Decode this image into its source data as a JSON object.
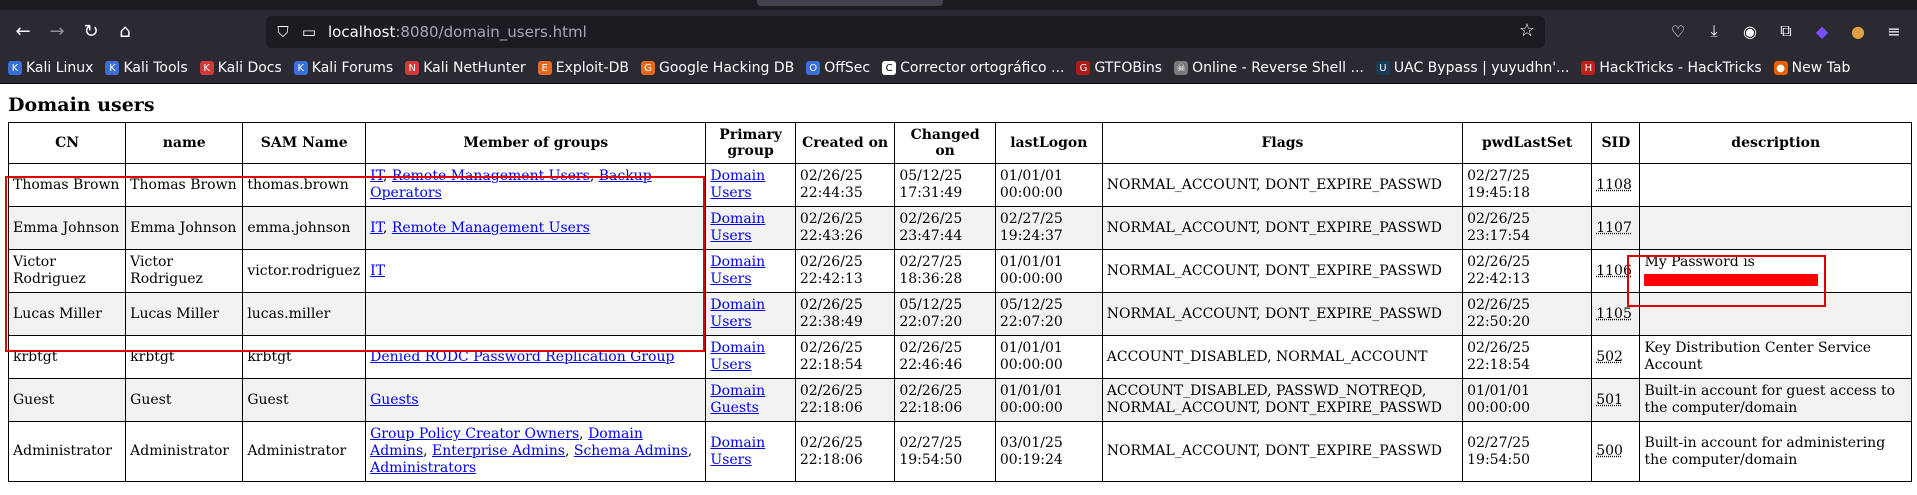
{
  "browser": {
    "url_host": "localhost",
    "url_path": ":8080/domain_users.html",
    "bookmarks": [
      {
        "label": "Kali Linux",
        "color": "#3a6fd8",
        "glyph": "K"
      },
      {
        "label": "Kali Tools",
        "color": "#3a6fd8",
        "glyph": "K"
      },
      {
        "label": "Kali Docs",
        "color": "#d13a3a",
        "glyph": "K"
      },
      {
        "label": "Kali Forums",
        "color": "#3a6fd8",
        "glyph": "K"
      },
      {
        "label": "Kali NetHunter",
        "color": "#d13a3a",
        "glyph": "N"
      },
      {
        "label": "Exploit-DB",
        "color": "#e36b1e",
        "glyph": "E"
      },
      {
        "label": "Google Hacking DB",
        "color": "#e36b1e",
        "glyph": "G"
      },
      {
        "label": "OffSec",
        "color": "#3a6fd8",
        "glyph": "O"
      },
      {
        "label": "Corrector ortográfico ...",
        "color": "#ffffff",
        "glyph": "C"
      },
      {
        "label": "GTFOBins",
        "color": "#b01919",
        "glyph": "G"
      },
      {
        "label": "Online - Reverse Shell ...",
        "color": "#7a7a7a",
        "glyph": "☠"
      },
      {
        "label": "UAC Bypass | yuyudhn'...",
        "color": "#1b3b5a",
        "glyph": "U"
      },
      {
        "label": "HackTricks - HackTricks",
        "color": "#c02020",
        "glyph": "H"
      },
      {
        "label": "New Tab",
        "color": "#e66000",
        "glyph": "●"
      }
    ]
  },
  "page": {
    "title": "Domain users",
    "columns": [
      "CN",
      "name",
      "SAM Name",
      "Member of groups",
      "Primary group",
      "Created on",
      "Changed on",
      "lastLogon",
      "Flags",
      "pwdLastSet",
      "SID",
      "description"
    ],
    "rows": [
      {
        "cn": "Thomas Brown",
        "name": "Thomas Brown",
        "sam": "thomas.brown",
        "groups": [
          "IT",
          "Remote Management Users",
          "Backup Operators"
        ],
        "primary": "Domain Users",
        "created": "02/26/25 22:44:35",
        "changed": "05/12/25 17:31:49",
        "lastlogon": "01/01/01 00:00:00",
        "flags": "NORMAL_ACCOUNT, DONT_EXPIRE_PASSWD",
        "pwdlastset": "02/27/25 19:45:18",
        "sid": "1108",
        "description": "",
        "redacted": false
      },
      {
        "cn": "Emma Johnson",
        "name": "Emma Johnson",
        "sam": "emma.johnson",
        "groups": [
          "IT",
          "Remote Management Users"
        ],
        "primary": "Domain Users",
        "created": "02/26/25 22:43:26",
        "changed": "02/26/25 23:47:44",
        "lastlogon": "02/27/25 19:24:37",
        "flags": "NORMAL_ACCOUNT, DONT_EXPIRE_PASSWD",
        "pwdlastset": "02/26/25 23:17:54",
        "sid": "1107",
        "description": "",
        "redacted": false
      },
      {
        "cn": "Victor Rodriguez",
        "name": "Victor Rodriguez",
        "sam": "victor.rodriguez",
        "groups": [
          "IT"
        ],
        "primary": "Domain Users",
        "created": "02/26/25 22:42:13",
        "changed": "02/27/25 18:36:28",
        "lastlogon": "01/01/01 00:00:00",
        "flags": "NORMAL_ACCOUNT, DONT_EXPIRE_PASSWD",
        "pwdlastset": "02/26/25 22:42:13",
        "sid": "1106",
        "description": "My Password is",
        "redacted": true
      },
      {
        "cn": "Lucas Miller",
        "name": "Lucas Miller",
        "sam": "lucas.miller",
        "groups": [],
        "primary": "Domain Users",
        "created": "02/26/25 22:38:49",
        "changed": "05/12/25 22:07:20",
        "lastlogon": "05/12/25 22:07:20",
        "flags": "NORMAL_ACCOUNT, DONT_EXPIRE_PASSWD",
        "pwdlastset": "02/26/25 22:50:20",
        "sid": "1105",
        "description": "",
        "redacted": false
      },
      {
        "cn": "krbtgt",
        "name": "krbtgt",
        "sam": "krbtgt",
        "groups": [
          "Denied RODC Password Replication Group"
        ],
        "primary": "Domain Users",
        "created": "02/26/25 22:18:54",
        "changed": "02/26/25 22:46:46",
        "lastlogon": "01/01/01 00:00:00",
        "flags": "ACCOUNT_DISABLED, NORMAL_ACCOUNT",
        "pwdlastset": "02/26/25 22:18:54",
        "sid": "502",
        "description": "Key Distribution Center Service Account",
        "redacted": false
      },
      {
        "cn": "Guest",
        "name": "Guest",
        "sam": "Guest",
        "groups": [
          "Guests"
        ],
        "primary": "Domain Guests",
        "created": "02/26/25 22:18:06",
        "changed": "02/26/25 22:18:06",
        "lastlogon": "01/01/01 00:00:00",
        "flags": "ACCOUNT_DISABLED, PASSWD_NOTREQD, NORMAL_ACCOUNT, DONT_EXPIRE_PASSWD",
        "pwdlastset": "01/01/01 00:00:00",
        "sid": "501",
        "description": "Built-in account for guest access to the computer/domain",
        "redacted": false
      },
      {
        "cn": "Administrator",
        "name": "Administrator",
        "sam": "Administrator",
        "groups": [
          "Group Policy Creator Owners",
          "Domain Admins",
          "Enterprise Admins",
          "Schema Admins",
          "Administrators"
        ],
        "primary": "Domain Users",
        "created": "02/26/25 22:18:06",
        "changed": "02/27/25 19:54:50",
        "lastlogon": "03/01/25 00:19:24",
        "flags": "NORMAL_ACCOUNT, DONT_EXPIRE_PASSWD",
        "pwdlastset": "02/27/25 19:54:50",
        "sid": "500",
        "description": "Built-in account for administering the computer/domain",
        "redacted": false
      }
    ]
  },
  "colors": {
    "highlight_box": "#e00000",
    "redaction": "#ff0000",
    "link": "#0000ee"
  }
}
